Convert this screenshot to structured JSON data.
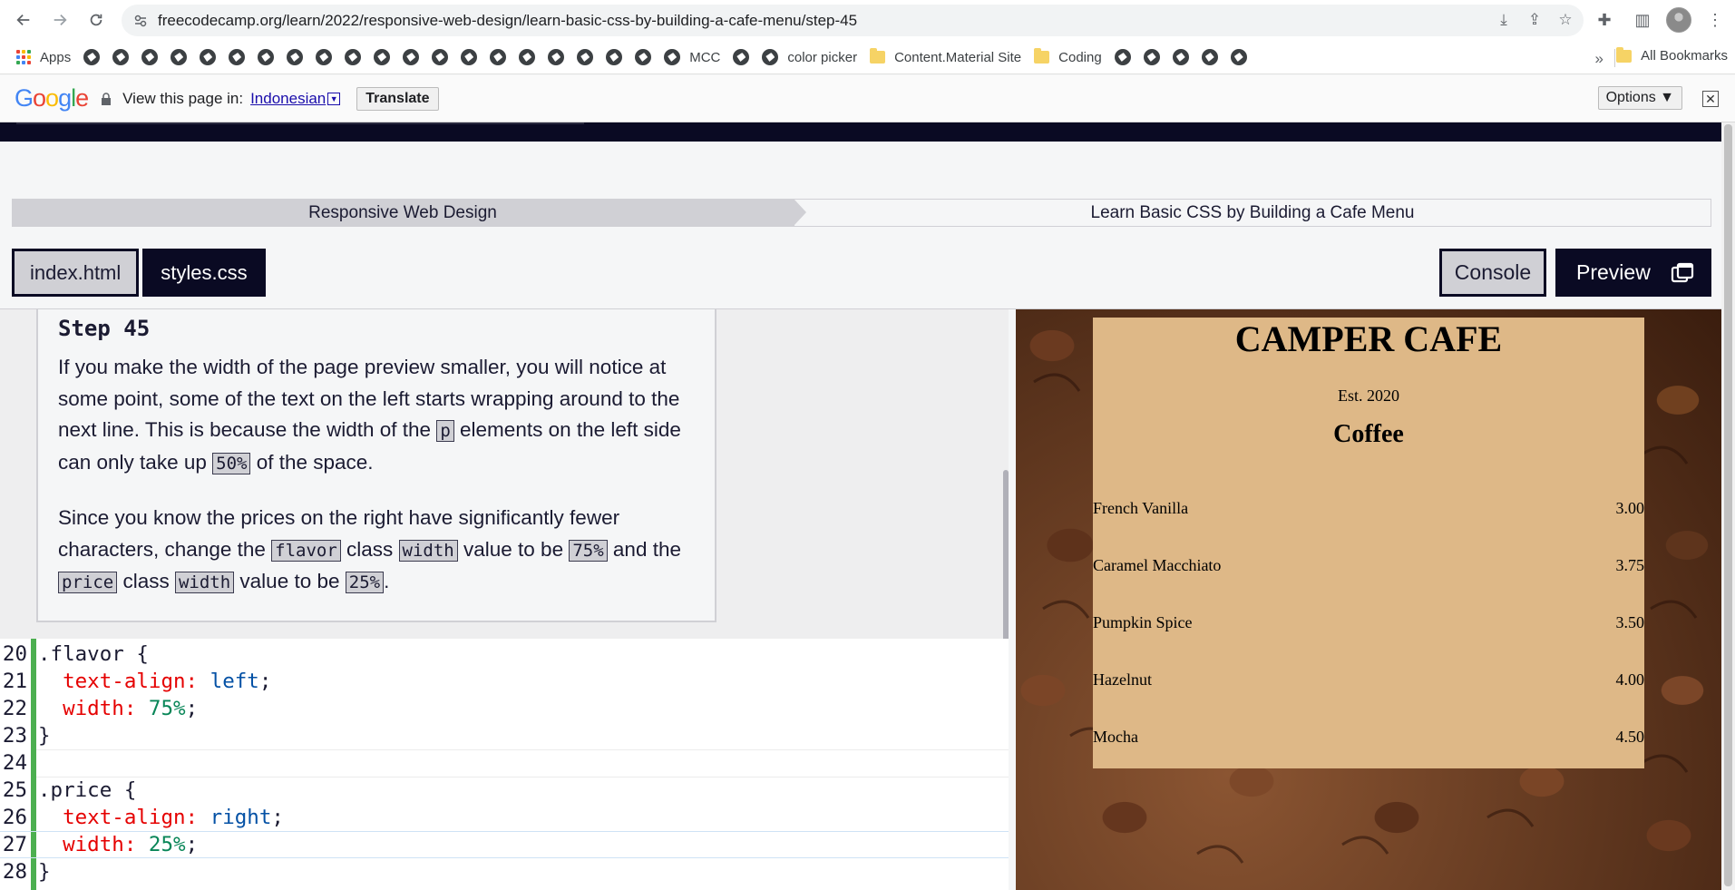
{
  "browser": {
    "url": "freecodecamp.org/learn/2022/responsive-web-design/learn-basic-css-by-building-a-cafe-menu/step-45",
    "bookmarks": [
      {
        "label": "Apps",
        "icon": "apps-grid-icon"
      },
      {
        "label": "",
        "icon": "globe-icon"
      },
      {
        "label": "",
        "icon": "globe-icon"
      },
      {
        "label": "",
        "icon": "globe-icon"
      },
      {
        "label": "",
        "icon": "globe-icon"
      },
      {
        "label": "",
        "icon": "globe-icon"
      },
      {
        "label": "",
        "icon": "globe-icon"
      },
      {
        "label": "",
        "icon": "globe-icon"
      },
      {
        "label": "",
        "icon": "globe-icon"
      },
      {
        "label": "",
        "icon": "globe-icon"
      },
      {
        "label": "",
        "icon": "globe-icon"
      },
      {
        "label": "",
        "icon": "globe-icon"
      },
      {
        "label": "",
        "icon": "globe-icon"
      },
      {
        "label": "",
        "icon": "globe-icon"
      },
      {
        "label": "",
        "icon": "globe-icon"
      },
      {
        "label": "",
        "icon": "globe-icon"
      },
      {
        "label": "",
        "icon": "globe-icon"
      },
      {
        "label": "",
        "icon": "globe-icon"
      },
      {
        "label": "",
        "icon": "globe-icon"
      },
      {
        "label": "",
        "icon": "globe-icon"
      },
      {
        "label": "",
        "icon": "globe-icon"
      },
      {
        "label": "MCC",
        "icon": "globe-icon"
      },
      {
        "label": "",
        "icon": "globe-icon"
      },
      {
        "label": "color picker",
        "icon": "globe-icon"
      },
      {
        "label": "Content.Material Site",
        "icon": "folder-icon"
      },
      {
        "label": "Coding",
        "icon": "folder-icon"
      },
      {
        "label": "",
        "icon": "globe-icon"
      },
      {
        "label": "",
        "icon": "globe-icon"
      },
      {
        "label": "",
        "icon": "globe-icon"
      },
      {
        "label": "",
        "icon": "globe-icon"
      },
      {
        "label": "",
        "icon": "globe-icon"
      }
    ],
    "bookmarks_overflow": "»",
    "all_bookmarks": "All Bookmarks"
  },
  "translate_bar": {
    "logo": [
      "G",
      "o",
      "o",
      "g",
      "l",
      "e"
    ],
    "prompt": "View this page in:",
    "language": "Indonesian",
    "language_arrow": "▼",
    "translate_button": "Translate",
    "options_button": "Options ▼",
    "close": "✕"
  },
  "breadcrumb": {
    "superblock": "Responsive Web Design",
    "block": "Learn Basic CSS by Building a Cafe Menu"
  },
  "tabs": {
    "files": [
      "index.html",
      "styles.css"
    ],
    "active_index": 1,
    "console": "Console",
    "preview": "Preview"
  },
  "instructions": {
    "title": "Step 45",
    "p1": [
      "If you make the width of the page preview smaller, you will notice at some point, some of the text on the left starts wrapping around to the next line. This is because the width of the ",
      "p",
      " elements on the left side can only take up ",
      "50%",
      " of the space."
    ],
    "p2": [
      "Since you know the prices on the right have significantly fewer characters, change the ",
      "flavor",
      " class ",
      "width",
      " value to be ",
      "75%",
      " and the ",
      "price",
      " class ",
      "width",
      " value to be ",
      "25%",
      "."
    ]
  },
  "editor": {
    "lines": [
      {
        "n": "20",
        "tokens": [
          {
            "t": ".flavor {",
            "c": "sel"
          }
        ]
      },
      {
        "n": "21",
        "tokens": [
          {
            "t": "  text-align: ",
            "c": "prop"
          },
          {
            "t": "left",
            "c": "val"
          },
          {
            "t": ";",
            "c": "sel"
          }
        ]
      },
      {
        "n": "22",
        "tokens": [
          {
            "t": "  width: ",
            "c": "prop"
          },
          {
            "t": "75%",
            "c": "num"
          },
          {
            "t": ";",
            "c": "sel"
          }
        ]
      },
      {
        "n": "23",
        "tokens": [
          {
            "t": "}",
            "c": "sel"
          }
        ]
      },
      {
        "n": "24",
        "tokens": []
      },
      {
        "n": "25",
        "tokens": [
          {
            "t": ".price {",
            "c": "sel"
          }
        ]
      },
      {
        "n": "26",
        "tokens": [
          {
            "t": "  text-align: ",
            "c": "prop"
          },
          {
            "t": "right",
            "c": "val"
          },
          {
            "t": ";",
            "c": "sel"
          }
        ]
      },
      {
        "n": "27",
        "tokens": [
          {
            "t": "  width: ",
            "c": "prop"
          },
          {
            "t": "25%",
            "c": "num"
          },
          {
            "t": ";",
            "c": "sel"
          }
        ]
      },
      {
        "n": "28",
        "tokens": [
          {
            "t": "}",
            "c": "sel"
          }
        ]
      }
    ]
  },
  "cafe_preview": {
    "title": "CAMPER CAFE",
    "established": "Est. 2020",
    "section": "Coffee",
    "items": [
      {
        "flavor": "French Vanilla",
        "price": "3.00"
      },
      {
        "flavor": "Caramel Macchiato",
        "price": "3.75"
      },
      {
        "flavor": "Pumpkin Spice",
        "price": "3.50"
      },
      {
        "flavor": "Hazelnut",
        "price": "4.00"
      },
      {
        "flavor": "Mocha",
        "price": "4.50"
      }
    ],
    "menu_color": "#deb887"
  },
  "colors": {
    "fcc_dark": "#0a0a23",
    "fcc_gray": "#d0d0d5",
    "editor_gutter": "#4caf50"
  }
}
